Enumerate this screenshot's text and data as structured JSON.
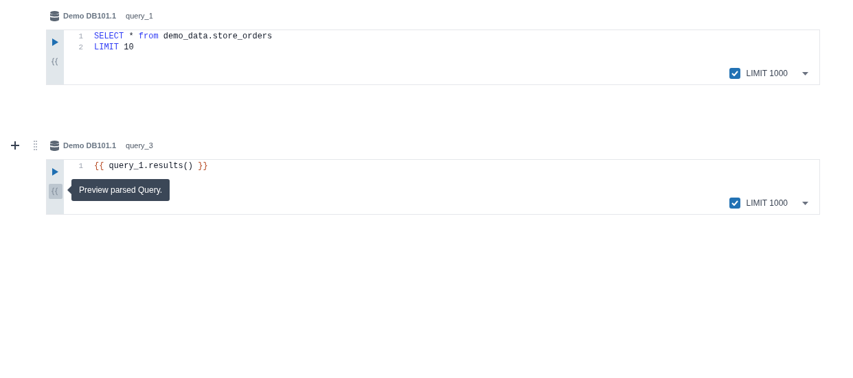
{
  "cells": [
    {
      "show_controls": false,
      "database": "Demo DB101.1",
      "name": "query_1",
      "preview_hover": false,
      "lines": [
        {
          "number": "1",
          "tokens": [
            {
              "kind": "keyword",
              "text": "SELECT"
            },
            {
              "kind": "plain",
              "text": " * "
            },
            {
              "kind": "keyword",
              "text": "from"
            },
            {
              "kind": "plain",
              "text": " demo_data.store_orders"
            }
          ]
        },
        {
          "number": "2",
          "tokens": [
            {
              "kind": "keyword",
              "text": "LIMIT"
            },
            {
              "kind": "plain",
              "text": " 10"
            }
          ]
        }
      ],
      "limit": {
        "checked": true,
        "label": "LIMIT 1000"
      }
    },
    {
      "show_controls": true,
      "database": "Demo DB101.1",
      "name": "query_3",
      "preview_hover": true,
      "tooltip": "Preview parsed Query.",
      "lines": [
        {
          "number": "1",
          "tokens": [
            {
              "kind": "brace",
              "text": "{{"
            },
            {
              "kind": "plain",
              "text": " query_1.results() "
            },
            {
              "kind": "brace",
              "text": "}}"
            }
          ]
        }
      ],
      "limit": {
        "checked": true,
        "label": "LIMIT 1000"
      }
    }
  ]
}
